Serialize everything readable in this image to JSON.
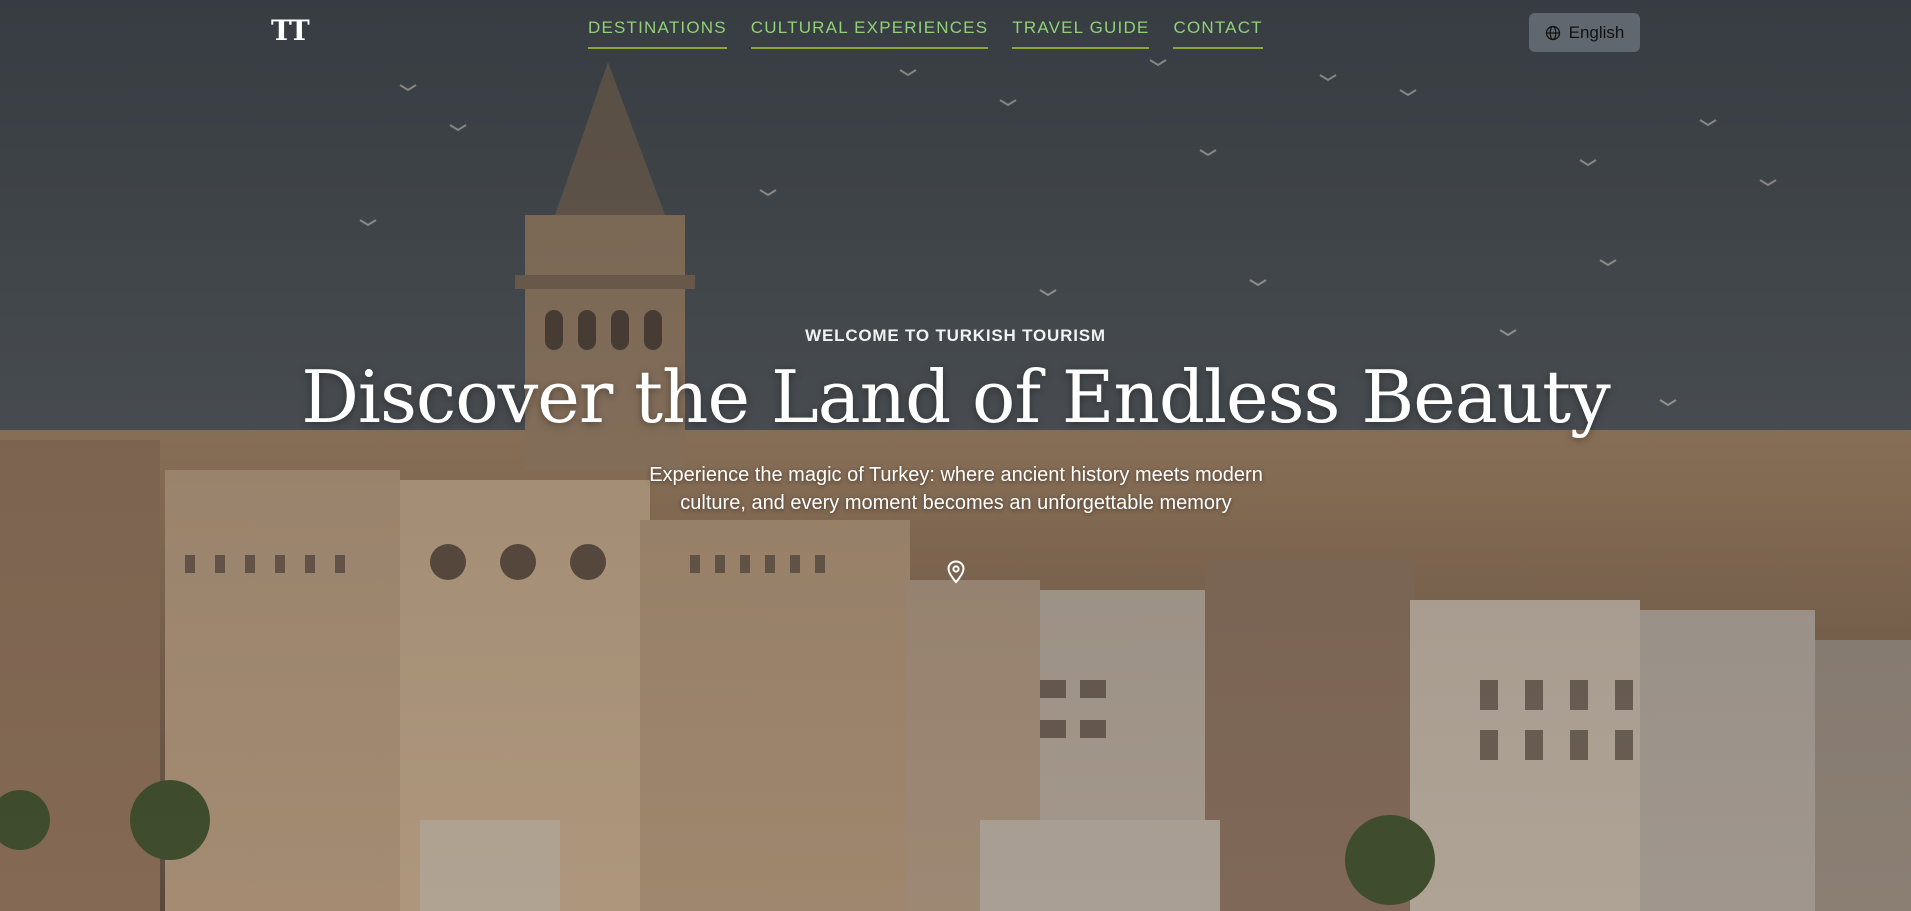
{
  "header": {
    "logo": "TT",
    "nav": [
      {
        "label": "DESTINATIONS"
      },
      {
        "label": "CULTURAL EXPERIENCES"
      },
      {
        "label": "TRAVEL GUIDE"
      },
      {
        "label": "CONTACT"
      }
    ],
    "language_button": {
      "label": "English",
      "icon": "globe-icon"
    }
  },
  "hero": {
    "eyebrow": "WELCOME TO TURKISH TOURISM",
    "headline": "Discover the Land of Endless Beauty",
    "subtitle": "Experience the magic of Turkey: where ancient history meets modern culture, and every moment becomes an unforgettable memory",
    "scroll_icon": "map-pin-icon",
    "background": "Istanbul skyline with Galata Tower and seagulls"
  },
  "colors": {
    "nav_text": "#8fd276",
    "nav_underline": "#8aa83a",
    "headline": "#ffffff",
    "sky": "#4b5157"
  }
}
